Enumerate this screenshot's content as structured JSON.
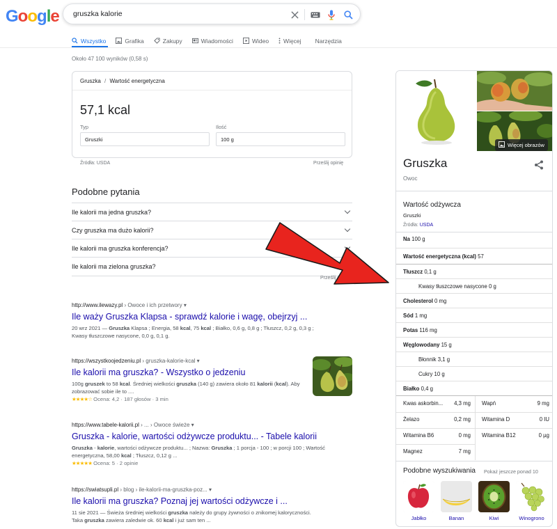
{
  "logo": {
    "letters": [
      "G",
      "o",
      "o",
      "g",
      "l",
      "e"
    ],
    "colors": [
      "#4285f4",
      "#ea4335",
      "#fbbc05",
      "#4285f4",
      "#34a853",
      "#ea4335"
    ]
  },
  "search": {
    "query": "gruszka kalorie"
  },
  "tabs": [
    {
      "label": "Wszystko",
      "icon": "search-icon",
      "active": true
    },
    {
      "label": "Grafika",
      "icon": "image-icon"
    },
    {
      "label": "Zakupy",
      "icon": "tag-icon"
    },
    {
      "label": "Wiadomości",
      "icon": "news-icon"
    },
    {
      "label": "Wideo",
      "icon": "play-icon"
    },
    {
      "label": "Więcej",
      "icon": "more-vert-icon"
    },
    {
      "label": "Narzędzia"
    }
  ],
  "stats": "Około 47 100 wyników (0,58 s)",
  "calorie_card": {
    "breadcrumb_1": "Gruszka",
    "breadcrumb_sep": "/",
    "breadcrumb_2": "Wartość energetyczna",
    "value": "57,1 kcal",
    "type_label": "Typ",
    "type_value": "Gruszki",
    "qty_label": "Ilość",
    "qty_value": "100 g",
    "source": "Źródła: USDA",
    "feedback": "Prześlij opinię"
  },
  "paa": {
    "title": "Podobne pytania",
    "questions": [
      "Ile kalorii ma jedna gruszka?",
      "Czy gruszka ma dużo kalorii?",
      "Ile kalorii ma gruszka konferencja?",
      "Ile kalorii ma zielona gruszka?"
    ],
    "feedback": "Prześlij opinię"
  },
  "results": [
    {
      "url_host": "http://www.ilewazy.pl",
      "url_path": " › Owoce i ich przetwory",
      "title": "Ile waży Gruszka Klapsa - sprawdź kalorie i wagę, obejrzyj ...",
      "snippet_1": "20 wrz 2021 — ",
      "snippet_2": "Gruszka",
      "snippet_3": " Klapsa ; Energia, 58 ",
      "snippet_4": "kcal",
      "snippet_5": ", 75 ",
      "snippet_6": "kcal",
      "snippet_7": " ; Białko, 0,6 g, 0,8 g ; Tłuszcz, 0,2 g, 0,3 g ; Kwasy tłuszczowe nasycone, 0,0 g, 0,1 g."
    },
    {
      "url_host": "https://wszystkoojedzeniu.pl",
      "url_path": " › gruszka-kalorie-kcal",
      "title": "Ile kalorii ma gruszka? - Wszystko o jedzeniu",
      "snippet_1": "100g ",
      "snippet_2": "gruszek",
      "snippet_3": " to 58 ",
      "snippet_4": "kcal",
      "snippet_5": ". Średniej wielkości ",
      "snippet_6": "gruszka",
      "snippet_7": " (140 g) zawiera około 81 ",
      "snippet_8": "kalorii",
      "snippet_9": " (",
      "snippet_10": "kcal",
      "snippet_11": "). Aby zobrazować sobie ile to ....",
      "stars": "★★★★☆",
      "rating": "Ocena: 4,2 · 187 głosów · 3 min"
    },
    {
      "url_host": "https://www.tabele-kalorii.pl",
      "url_path": " › ... › Owoce świeże",
      "title": "Gruszka - kalorie, wartości odżywcze produktu... - Tabele kalorii",
      "snippet_1": "Gruszka",
      "snippet_2": " - ",
      "snippet_3": "kalorie",
      "snippet_4": ", wartości odżywcze produktu... ; Nazwa: ",
      "snippet_5": "Gruszka",
      "snippet_6": " ; 1 porcja - 100 ; w porcji 100 ; Wartość energetyczna, 58,00 ",
      "snippet_7": "kcal",
      "snippet_8": " ; Tłuszcz, 0,12 g ...",
      "stars": "★★★★★",
      "rating": "Ocena: 5 · 2 opinie"
    },
    {
      "url_host": "https://swiatsupli.pl",
      "url_path": " › blog › ile-kalorii-ma-gruszka-poz...",
      "title": "Ile kalorii ma gruszka? Poznaj jej wartości odżywcze i ...",
      "snippet_1": "11 sie 2021 — Świeża średniej wielkości ",
      "snippet_2": "gruszka",
      "snippet_3": " należy do grupy żywności o znikomej kaloryczności. Taka ",
      "snippet_4": "gruszka",
      "snippet_5": " zawiera zaledwie ok. 60 ",
      "snippet_6": "kcal",
      "snippet_7": " i już sam ten ..."
    }
  ],
  "kp": {
    "more_images": "Więcej obrazów",
    "name": "Gruszka",
    "type": "Owoc",
    "nutrition_title": "Wartość odżywcza",
    "nutrition_sub": "Gruszki",
    "source_label": "Źródła: ",
    "source_link": "USDA",
    "rows": [
      {
        "k": "Na",
        "v": " 100 g"
      },
      {
        "k": "Wartość energetyczna (kcal)",
        "v": " 57"
      },
      {
        "k": "Tłuszcz",
        "v": " 0,1 g"
      },
      {
        "k": "",
        "v": "Kwasy tłuszczowe nasycone 0 g"
      },
      {
        "k": "Cholesterol",
        "v": " 0 mg"
      },
      {
        "k": "Sód",
        "v": " 1 mg"
      },
      {
        "k": "Potas",
        "v": " 116 mg"
      },
      {
        "k": "Węglowodany",
        "v": " 15 g"
      },
      {
        "k": "",
        "v": "Błonnik 3,1 g"
      },
      {
        "k": "",
        "v": "Cukry 10 g"
      },
      {
        "k": "Białko",
        "v": " 0,4 g"
      }
    ],
    "minerals": [
      {
        "k": "Kwas askorbin...",
        "v": "4,3 mg"
      },
      {
        "k": "Wapń",
        "v": "9 mg"
      },
      {
        "k": "Żelazo",
        "v": "0,2 mg"
      },
      {
        "k": "Witamina D",
        "v": "0 IU"
      },
      {
        "k": "Witamina B6",
        "v": "0 mg"
      },
      {
        "k": "Witamina B12",
        "v": "0 µg"
      },
      {
        "k": "Magnez",
        "v": "7 mg"
      }
    ],
    "similar_title": "Podobne wyszukiwania",
    "similar_more": "Pokaż jeszcze ponad 10",
    "similar": [
      "Jabłko",
      "Banan",
      "Kiwi",
      "Winogrono"
    ]
  },
  "colors": {
    "link": "#1a0dab",
    "accent": "#1a73e8",
    "arrow": "#e8241e",
    "star": "#fbbc04"
  }
}
